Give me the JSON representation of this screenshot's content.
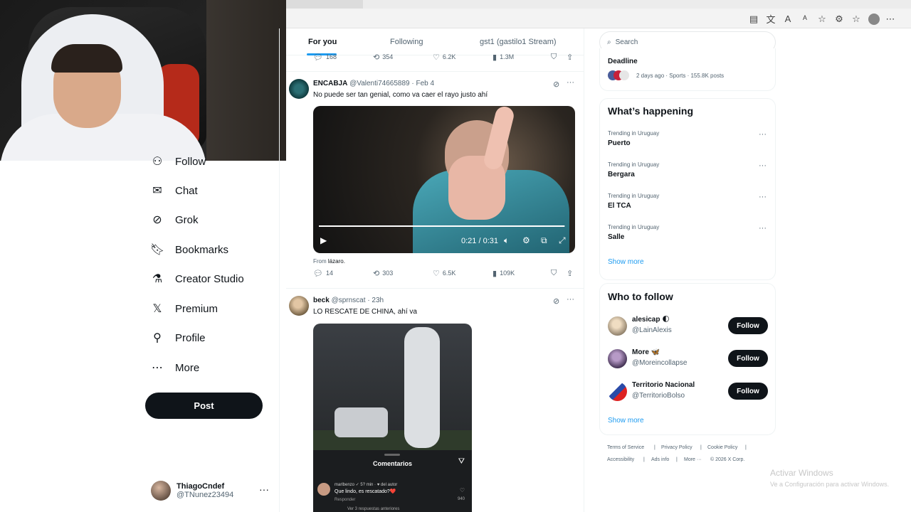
{
  "browser": {
    "toolbar_icons": [
      "reading-view-icon",
      "translate-icon",
      "read-aloud-icon",
      "font-icon",
      "favorites-star-icon",
      "extensions-icon",
      "collections-icon",
      "profile-icon"
    ]
  },
  "nav": {
    "partial_item": "Follow",
    "items": [
      {
        "label": "Chat",
        "icon": "chat-icon"
      },
      {
        "label": "Grok",
        "icon": "grok-icon"
      },
      {
        "label": "Bookmarks",
        "icon": "bookmark-icon"
      },
      {
        "label": "Creator Studio",
        "icon": "creator-studio-icon"
      },
      {
        "label": "Premium",
        "icon": "x-logo-icon"
      },
      {
        "label": "Profile",
        "icon": "profile-icon"
      },
      {
        "label": "More",
        "icon": "more-circle-icon"
      }
    ],
    "post_label": "Post",
    "account": {
      "name": "ThiagoCndef",
      "handle": "@TNunez23494",
      "more": "···"
    }
  },
  "timeline": {
    "tabs": [
      {
        "label": "For you",
        "active": true
      },
      {
        "label": "Following",
        "active": false
      },
      {
        "label": "gst1 (gastilo1 Stream)",
        "active": false
      }
    ],
    "top_actions": {
      "replies": "168",
      "reposts": "354",
      "likes": "6.2K",
      "views": "1.3M"
    },
    "tweets": [
      {
        "name": "ENCABJA",
        "handle": "@Valenti74665889",
        "date": "· Feb 4",
        "text": "No puede ser tan genial, como va caer el rayo justo ahí",
        "video_time": "0:21 / 0:31",
        "from_label": "From",
        "from_source": "lázaro.",
        "actions": {
          "replies": "14",
          "reposts": "303",
          "likes": "6.5K",
          "views": "109K"
        }
      },
      {
        "name": "beck",
        "handle": "@sprnscat",
        "date": "· 23h",
        "text": "LO RESCATE DE CHINA, ahí va",
        "sheet_title": "Comentarios",
        "comment_user": "marlbenzo ✓ 5? min · ♥ del autor",
        "comment_text": "Que lindo, es rescatado?❤️",
        "comment_reply": "Responder",
        "comment_count": "940",
        "comment_more": "Ver 3 respuestas anteriores"
      }
    ]
  },
  "right": {
    "search_placeholder": "Search",
    "top_trend": {
      "name": "Deadline",
      "meta": "2 days ago · Sports · 155.8K posts"
    },
    "whats_happening_title": "What’s happening",
    "trends": [
      {
        "meta": "Trending in Uruguay",
        "name": "Puerto"
      },
      {
        "meta": "Trending in Uruguay",
        "name": "Bergara"
      },
      {
        "meta": "Trending in Uruguay",
        "name": "El TCA"
      },
      {
        "meta": "Trending in Uruguay",
        "name": "Salle"
      }
    ],
    "show_more": "Show more",
    "who_to_follow_title": "Who to follow",
    "follow": [
      {
        "name": "alesicap 🌓",
        "handle": "@LainAlexis",
        "button": "Follow"
      },
      {
        "name": "More 🦋",
        "handle": "@Moreincollapse",
        "button": "Follow"
      },
      {
        "name": "Territorio Nacional",
        "handle": "@TerritorioBolso",
        "button": "Follow"
      }
    ],
    "show_more_2": "Show more",
    "footer": [
      "Terms of Service",
      "|",
      "Privacy Policy",
      "|",
      "Cookie Policy",
      "|",
      "Accessibility",
      "|",
      "Ads info",
      "|",
      "More ···",
      "© 2026 X Corp."
    ]
  },
  "watermark": {
    "line1": "Activar Windows",
    "line2": "Ve a Configuración para activar Windows."
  },
  "colors": {
    "accent": "#1d9bf0",
    "text": "#0f1419",
    "muted": "#536471",
    "button": "#0f1419"
  }
}
